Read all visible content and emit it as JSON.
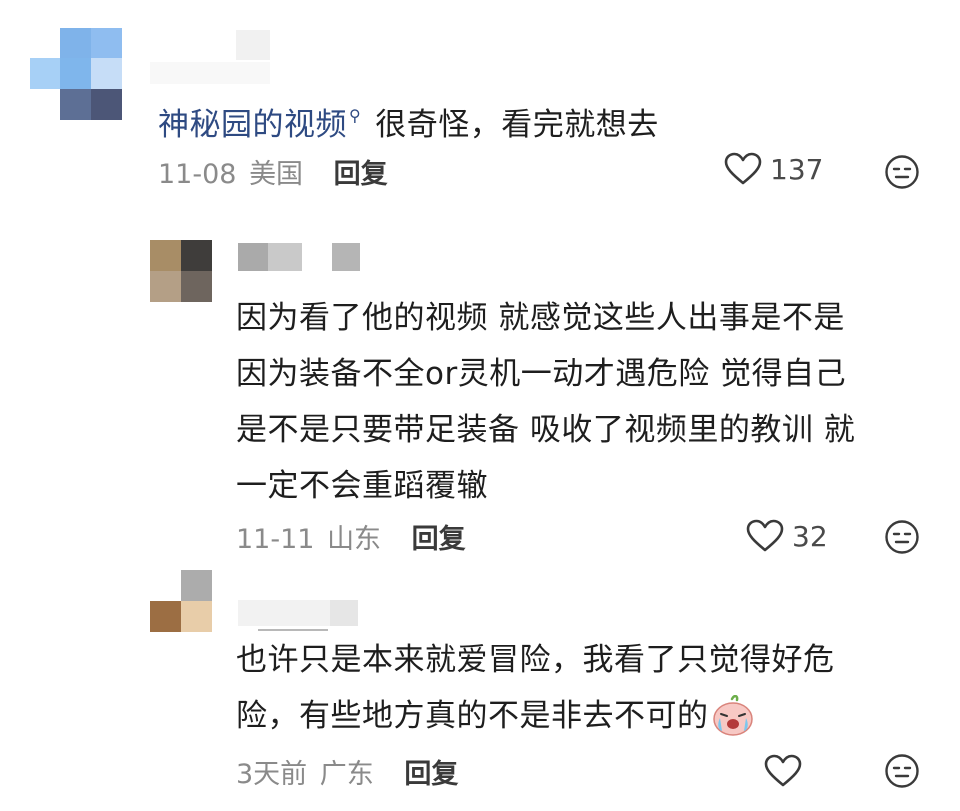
{
  "comments": [
    {
      "link_text": "神秘园的视频",
      "text": "很奇怪，看完就想去",
      "date": "11-08",
      "location": "美国",
      "reply_label": "回复",
      "likes": "137"
    },
    {
      "text_lines": [
        "因为看了他的视频 就感觉这些人出事是不是",
        "因为装备不全or灵机一动才遇危险 觉得自己",
        "是不是只要带足装备 吸收了视频里的教训 就",
        "一定不会重蹈覆辙"
      ],
      "date": "11-11",
      "location": "山东",
      "reply_label": "回复",
      "likes": "32"
    },
    {
      "text_lines": [
        "也许只是本来就爱冒险，我看了只觉得好危",
        "险，有些地方真的不是非去不可的"
      ],
      "date": "3天前",
      "location": "广东",
      "reply_label": "回复",
      "likes": ""
    }
  ],
  "icons": {
    "search": "search-icon",
    "heart": "heart-outline-icon",
    "emoji": "expressionless-face-icon",
    "sticker": "crying-face-emoji"
  }
}
